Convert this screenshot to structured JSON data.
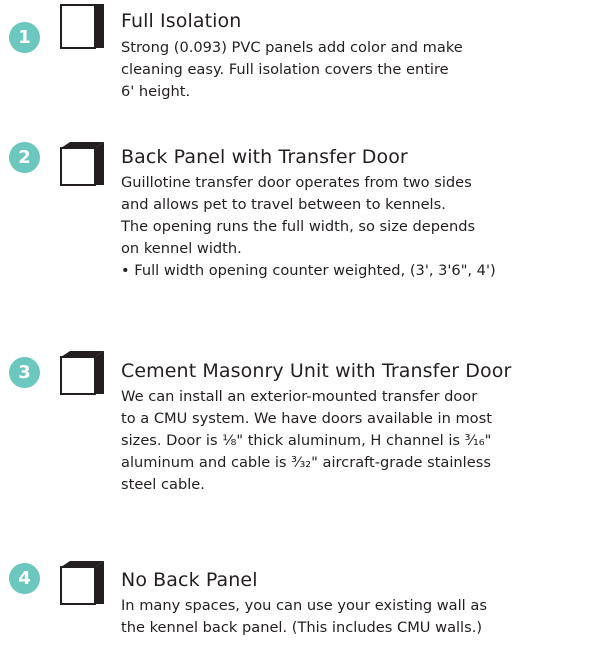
{
  "accent": "#6cc7be",
  "icon": "cube-panel-icon",
  "items": [
    {
      "number": "1",
      "title": "Full Isolation",
      "lines": [
        "Strong (0.093) PVC panels add color and make",
        "cleaning easy. Full isolation covers the entire",
        "6' height."
      ]
    },
    {
      "number": "2",
      "title": "Back Panel with Transfer Door",
      "lines": [
        "Guillotine transfer door operates from two sides",
        "and allows pet to travel between to kennels.",
        "The opening runs the full width, so size depends",
        "on kennel width."
      ],
      "bullet": "• Full width opening counter weighted, (3', 3'6\", 4')"
    },
    {
      "number": "3",
      "title": "Cement Masonry Unit with Transfer Door",
      "lines": [
        "We can install an exterior-mounted transfer door",
        "to a CMU system. We have doors available in most",
        "sizes. Door is ⅛\" thick aluminum, H channel is ³⁄₁₆\"",
        "aluminum and cable is ³⁄₃₂\" aircraft-grade stainless",
        "steel cable."
      ]
    },
    {
      "number": "4",
      "title": "No Back Panel",
      "lines": [
        "In many spaces, you can use your existing wall as",
        "the kennel back panel. (This includes CMU walls.)"
      ]
    }
  ]
}
